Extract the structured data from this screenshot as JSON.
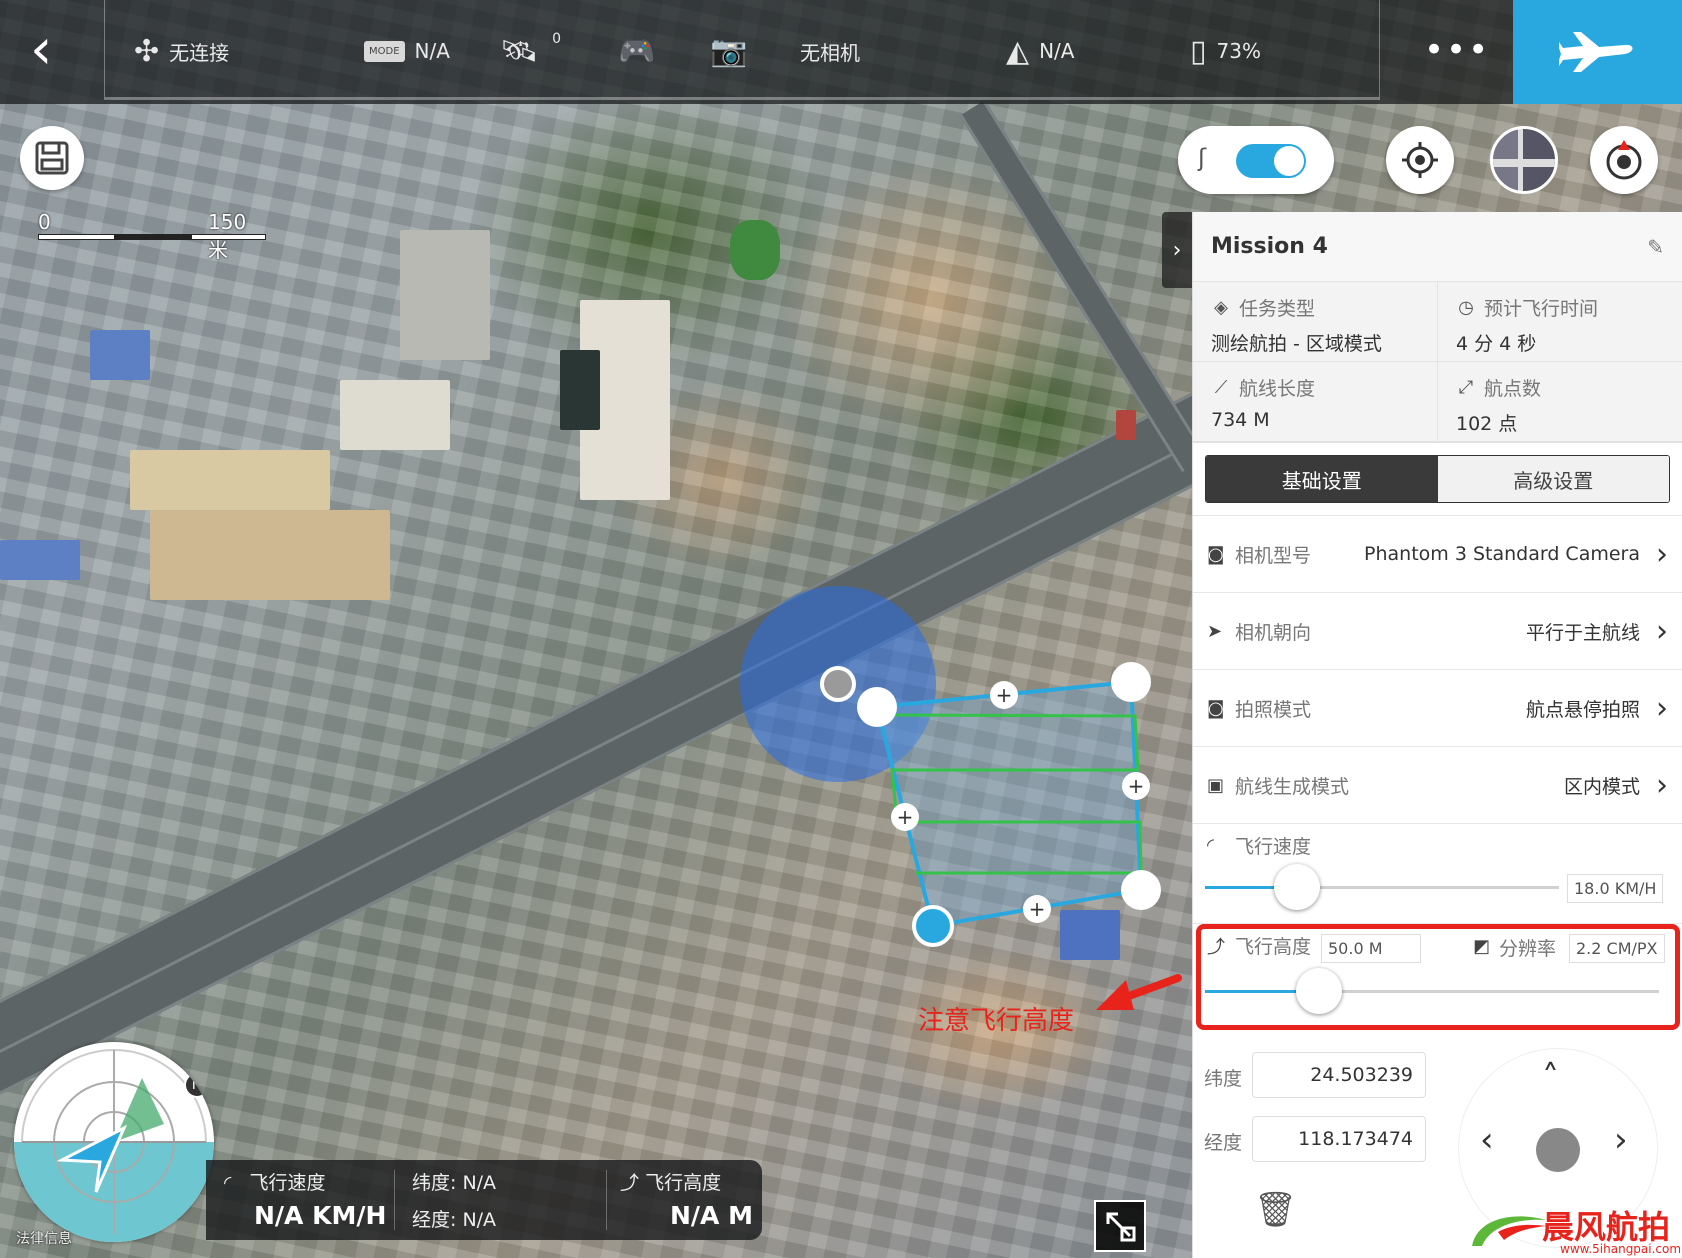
{
  "topbar": {
    "connection": "无连接",
    "mode_badge": "MODE",
    "mode_value": "N/A",
    "gps_count": "0",
    "camera": "无相机",
    "gps_mode": "N/A",
    "battery": "73%"
  },
  "map": {
    "scale_start": "0",
    "scale_end": "150 米",
    "annotation": "注意飞行高度",
    "legal": "法律信息",
    "north": "N"
  },
  "mission": {
    "title": "Mission 4",
    "info": {
      "type_label": "任务类型",
      "type_value": "测绘航拍 - 区域模式",
      "time_label": "预计飞行时间",
      "time_value": "4 分 4 秒",
      "length_label": "航线长度",
      "length_value": "734 M",
      "points_label": "航点数",
      "points_value": "102 点"
    },
    "tabs": {
      "basic": "基础设置",
      "advanced": "高级设置"
    },
    "settings": [
      {
        "label": "相机型号",
        "value": "Phantom 3 Standard Camera"
      },
      {
        "label": "相机朝向",
        "value": "平行于主航线"
      },
      {
        "label": "拍照模式",
        "value": "航点悬停拍照"
      },
      {
        "label": "航线生成模式",
        "value": "区内模式"
      }
    ],
    "speed": {
      "label": "飞行速度",
      "value": "18.0 KM/H",
      "level": 0.26
    },
    "altitude": {
      "label": "飞行高度",
      "value": "50.0 M",
      "res_label": "分辨率",
      "res_value": "2.2 CM/PX",
      "level": 0.25
    },
    "coords": {
      "lat_label": "纬度",
      "lat_value": "24.503239",
      "lng_label": "经度",
      "lng_value": "118.173474"
    }
  },
  "telemetry": {
    "speed_label": "飞行速度",
    "speed_value": "N/A KM/H",
    "lat": "纬度: N/A",
    "lng": "经度: N/A",
    "alt_label": "飞行高度",
    "alt_value": "N/A M"
  },
  "watermark": {
    "name": "晨风航拍",
    "url": "www.5ihangpai.com"
  },
  "colors": {
    "accent": "#29a8e0",
    "highlight": "#e8231c",
    "route": "#35c24a"
  }
}
